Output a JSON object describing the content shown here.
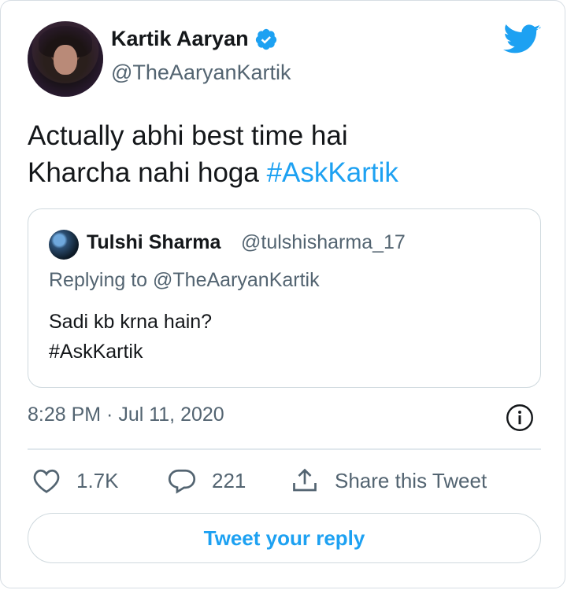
{
  "author": {
    "display_name": "Kartik Aaryan",
    "handle": "@TheAaryanKartik",
    "verified": true,
    "avatar_icon": "profile-photo"
  },
  "tweet": {
    "line1": "Actually abhi best time hai",
    "line2_text": "Kharcha nahi hoga ",
    "hashtag": "#AskKartik"
  },
  "quoted_tweet": {
    "display_name": "Tulshi Sharma",
    "handle": "@tulshisharma_17",
    "replying_to": "Replying to @TheAaryanKartik",
    "text_line1": "Sadi kb krna hain?",
    "text_line2": "#AskKartik"
  },
  "timestamp": "8:28 PM · Jul 11, 2020",
  "actions": {
    "likes": "1.7K",
    "replies": "221",
    "share_label": "Share this Tweet"
  },
  "reply_button_label": "Tweet your reply",
  "colors": {
    "accent": "#1da1f2",
    "text_primary": "#14171a",
    "text_secondary": "#536471",
    "border": "#cfd9de"
  }
}
